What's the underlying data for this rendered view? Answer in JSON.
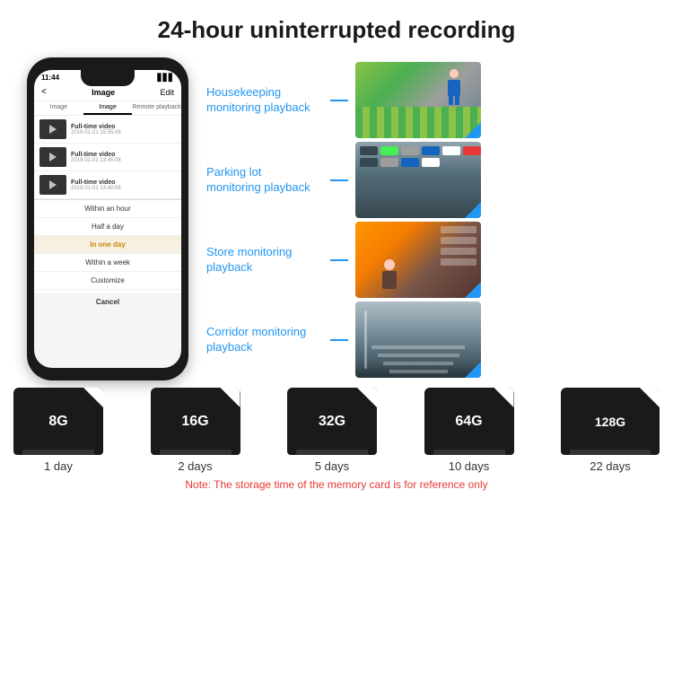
{
  "header": {
    "title": "24-hour uninterrupted recording"
  },
  "phone": {
    "status_time": "11:44",
    "nav_title": "Image",
    "nav_edit": "Edit",
    "nav_back": "<",
    "tabs": [
      "Image",
      "Image",
      "Remote playback"
    ],
    "list_items": [
      {
        "title": "Full-time video",
        "date": "2019-01-01 15:55:08"
      },
      {
        "title": "Full-time video",
        "date": "2019-01-01 13:45:08"
      },
      {
        "title": "Full-time video",
        "date": "2019-01-01 13:40:08"
      }
    ],
    "popup_items": [
      {
        "label": "Within an hour",
        "highlighted": false
      },
      {
        "label": "Half a day",
        "highlighted": false
      },
      {
        "label": "In one day",
        "highlighted": true
      },
      {
        "label": "Within a week",
        "highlighted": false
      },
      {
        "label": "Customize",
        "highlighted": false
      }
    ],
    "cancel_label": "Cancel"
  },
  "monitoring": {
    "items": [
      {
        "label": "Housekeeping\nmonitoring playback",
        "img_type": "housekeeping"
      },
      {
        "label": "Parking lot\nmonitoring playback",
        "img_type": "parking"
      },
      {
        "label": "Store monitoring\nplayback",
        "img_type": "store"
      },
      {
        "label": "Corridor monitoring\nplayback",
        "img_type": "corridor"
      }
    ]
  },
  "storage": {
    "cards": [
      {
        "size": "8G",
        "days": "1 day"
      },
      {
        "size": "16G",
        "days": "2 days"
      },
      {
        "size": "32G",
        "days": "5 days"
      },
      {
        "size": "64G",
        "days": "10 days"
      },
      {
        "size": "128G",
        "days": "22 days"
      }
    ],
    "note": "Note: The storage time of the memory card is for reference only"
  }
}
